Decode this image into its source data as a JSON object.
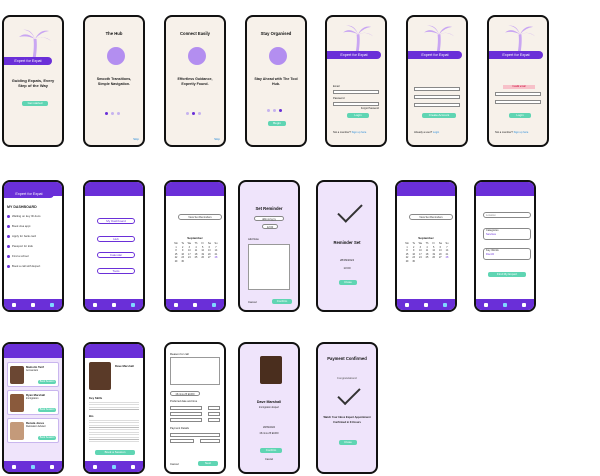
{
  "colors": {
    "primary": "#6a2fd8",
    "accent": "#5fd5b3",
    "cream": "#f7f1ea",
    "lilac": "#efe4fb"
  },
  "splash": {
    "banner": "Expert for Expat",
    "tagline": "Guiding Expats, Every Step of the Way",
    "button": "Get started"
  },
  "hub": {
    "title": "The Hub",
    "text": "Smooth Transitions, Simple Navigation.",
    "skip": "Skip"
  },
  "connect": {
    "title": "Connect Easily",
    "text": "Effortless Guidance, Expertly Found.",
    "skip": "Skip"
  },
  "organised": {
    "title": "Stay Organised",
    "text": "Stay Ahead with The Tool Hub.",
    "button": "Begin"
  },
  "login": {
    "banner": "Expert for Expat",
    "email_label": "Email",
    "password_label": "Password",
    "forgot": "Forgot Password",
    "button": "Login",
    "footer": "Not a member?",
    "footer_link": "Sign up here"
  },
  "signup": {
    "banner": "Expert for Expat",
    "button": "Create Account",
    "footer": "Already a user?",
    "footer_link": "Login"
  },
  "login_error": {
    "banner": "Expert for Expat",
    "error": "Invalid email",
    "button": "Login",
    "footer": "Not a member?",
    "footer_link": "Sign up here"
  },
  "dashboard": {
    "banner": "Expert for Expat",
    "heading": "MY DASHBOARD",
    "items": [
      "Waiting on key ID docs",
      "Book visa appt",
      "Apply for bank card",
      "Passport for kids",
      "Find a school",
      "Book a call with Expert"
    ]
  },
  "menu": {
    "items": [
      "My Dashboard",
      "Hub",
      "Calendar",
      "Tools"
    ]
  },
  "calendar": {
    "select": "View Set Reminders",
    "month": "September",
    "days": [
      "Mo",
      "Tu",
      "We",
      "Th",
      "Fr",
      "Sa",
      "Su"
    ]
  },
  "reminder": {
    "title": "Set Reminder",
    "date": "dd/mm/yyyy",
    "time": "12:00",
    "note_label": "Add Note",
    "cancel": "Cancel",
    "confirm": "Confirm"
  },
  "reminder_set": {
    "title": "Reminder Set",
    "date": "28/09/2024",
    "time": "13:00",
    "button": "Close"
  },
  "search": {
    "location": "Location",
    "categories": "Categories",
    "category_value": "Services",
    "keywords": "Key Words",
    "keyword_value": "Doc-ID",
    "button": "Find My Expert"
  },
  "experts": [
    {
      "name": "Malcolm Tarif",
      "role": "Accountant",
      "button": "Book Session"
    },
    {
      "name": "Ryan Marshall",
      "role": "Immigration",
      "button": "Book Session"
    },
    {
      "name": "Renata Jones",
      "role": "Relocation Advisor",
      "button": "Book Session"
    }
  ],
  "profile": {
    "name": "Dave Marshall",
    "bio_label": "Bio",
    "keyskills_label": "Key Skills",
    "button": "Book a Session"
  },
  "booking": {
    "reason": "Reason for call",
    "duration": "15 mins 25 EURO",
    "prefs": "Preferred date and time",
    "payment": "Payment Details",
    "cancel": "Cancel",
    "next": "Next"
  },
  "summary": {
    "name": "Dave Marshall",
    "role": "Immigration Expert",
    "date": "28/09/2024",
    "price": "15 mins 25 EURO",
    "confirm": "Confirm",
    "cancel": "Cancel"
  },
  "confirmed": {
    "title": "Payment Confirmed",
    "congrats": "Congratulations!",
    "text": "Watch Your Inbox Expert Appointment Confirmed in 24 Hours",
    "button": "Close"
  }
}
